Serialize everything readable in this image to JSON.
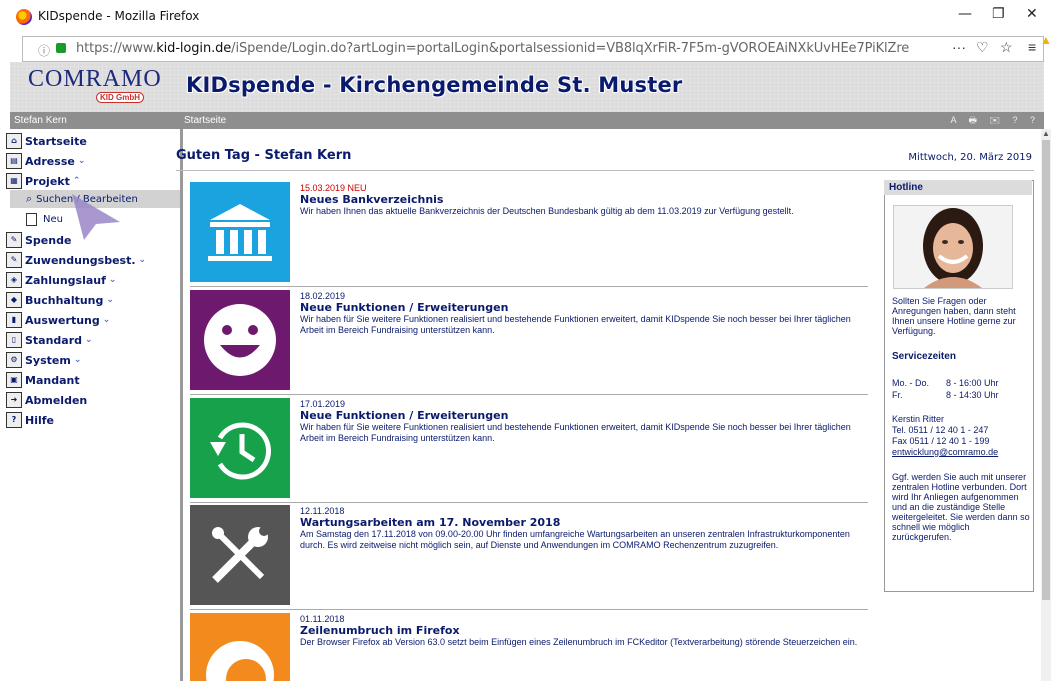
{
  "window": {
    "title": "KIDspende - Mozilla Firefox",
    "minimize": "—",
    "restore": "❐",
    "close": "✕"
  },
  "browser": {
    "url_domain": "kid-login.de",
    "url_prefix": "https://www.",
    "url_suffix": "/iSpende/Login.do?artLogin=portalLogin&portalsessionid=VB8lqXrFiR-7F5m-gVOROEAiNXkUvHEe7PiKlZre",
    "menu_dots": "···",
    "pocket": "♡",
    "star": "☆",
    "overflow": "≡"
  },
  "banner": {
    "logo_main": "COMRAMO",
    "logo_sub": "KID GmbH",
    "title": "KIDspende - Kirchengemeinde St. Muster"
  },
  "subbar": {
    "user": "Stefan Kern",
    "crumb": "Startseite",
    "icons": "A 🖶 ✉ ? ?"
  },
  "nav": {
    "items": [
      {
        "label": "Startseite",
        "icon": "home-icon",
        "glyph": "⌂",
        "caret": ""
      },
      {
        "label": "Adresse",
        "icon": "address-icon",
        "glyph": "▤",
        "caret": "⌄"
      },
      {
        "label": "Projekt",
        "icon": "project-icon",
        "glyph": "▦",
        "caret": "⌃"
      },
      {
        "label": "Spende",
        "icon": "donation-icon",
        "glyph": "✎",
        "caret": ""
      },
      {
        "label": "Zuwendungsbest.",
        "icon": "certificate-icon",
        "glyph": "✎",
        "caret": "⌄"
      },
      {
        "label": "Zahlungslauf",
        "icon": "payment-icon",
        "glyph": "◈",
        "caret": "⌄"
      },
      {
        "label": "Buchhaltung",
        "icon": "accounting-icon",
        "glyph": "◆",
        "caret": "⌄"
      },
      {
        "label": "Auswertung",
        "icon": "chart-icon",
        "glyph": "▮",
        "caret": "⌄"
      },
      {
        "label": "Standard",
        "icon": "standard-icon",
        "glyph": "▯",
        "caret": "⌄"
      },
      {
        "label": "System",
        "icon": "system-icon",
        "glyph": "⚙",
        "caret": "⌄"
      },
      {
        "label": "Mandant",
        "icon": "client-icon",
        "glyph": "▣",
        "caret": ""
      },
      {
        "label": "Abmelden",
        "icon": "logout-icon",
        "glyph": "➜",
        "caret": ""
      },
      {
        "label": "Hilfe",
        "icon": "help-icon",
        "glyph": "?",
        "caret": ""
      }
    ],
    "sub_search": "Suchen / Bearbeiten",
    "sub_new": "Neu"
  },
  "main": {
    "greeting": "Guten Tag - Stefan Kern",
    "date": "Mittwoch, 20. März 2019",
    "news": [
      {
        "date": "15.03.2019 NEU",
        "title": "Neues Bankverzeichnis",
        "body": "Wir haben Ihnen das aktuelle Bankverzeichnis der Deutschen Bundesbank gültig ab dem 11.03.2019 zur Verfügung gestellt.",
        "icon": "bank-icon",
        "color": "#1aa3df"
      },
      {
        "date": "18.02.2019",
        "title": "Neue Funktionen / Erweiterungen",
        "body": "Wir haben für Sie weitere Funktionen realisiert und bestehende Funktionen erweitert, damit KIDspende Sie noch besser bei Ihrer täglichen Arbeit im Bereich Fundraising unterstützen kann.",
        "icon": "smiley-icon",
        "color": "#6d1a6e"
      },
      {
        "date": "17.01.2019",
        "title": "Neue Funktionen / Erweiterungen",
        "body": "Wir haben für Sie weitere Funktionen realisiert und bestehende Funktionen erweitert, damit KIDspende Sie noch besser bei Ihrer täglichen Arbeit im Bereich Fundraising unterstützen kann.",
        "icon": "history-clock-icon",
        "color": "#16a14a"
      },
      {
        "date": "12.11.2018",
        "title": "Wartungsarbeiten am 17. November 2018",
        "body": "Am Samstag den 17.11.2018 von 09.00-20.00 Uhr finden umfangreiche Wartungsarbeiten an unseren zentralen Infrastrukturkomponenten durch. Es wird zeitweise nicht möglich sein, auf Dienste und Anwendungen im COMRAMO Rechenzentrum zuzugreifen.",
        "icon": "tools-icon",
        "color": "#555555"
      },
      {
        "date": "01.11.2018",
        "title": "Zeilenumbruch im Firefox",
        "body": "Der Browser Firefox ab Version 63.0 setzt beim Einfügen eines Zeilenumbruch im FCKeditor (Textverarbeitung) störende Steuerzeichen ein.",
        "icon": "firefox-icon",
        "color": "#f28a1e"
      }
    ]
  },
  "hotline": {
    "heading": "Hotline",
    "intro": "Sollten Sie Fragen oder Anregungen haben, dann steht Ihnen unsere Hotline gerne zur Verfügung.",
    "service_heading": "Servicezeiten",
    "hours1_days": "Mo. - Do.",
    "hours1_time": "8 - 16:00 Uhr",
    "hours2_days": "Fr.",
    "hours2_time": "8 - 14:30 Uhr",
    "contact_name": "Kerstin Ritter",
    "tel": "Tel. 0511 / 12 40 1 - 247",
    "fax": "Fax 0511 / 12 40 1 - 199",
    "email": "entwicklung@comramo.de",
    "note": "Ggf. werden Sie auch mit unserer zentralen Hotline verbunden. Dort wird Ihr Anliegen aufgenommen und an die zuständige Stelle weitergeleitet. Sie werden dann so schnell wie möglich zurückgerufen."
  }
}
